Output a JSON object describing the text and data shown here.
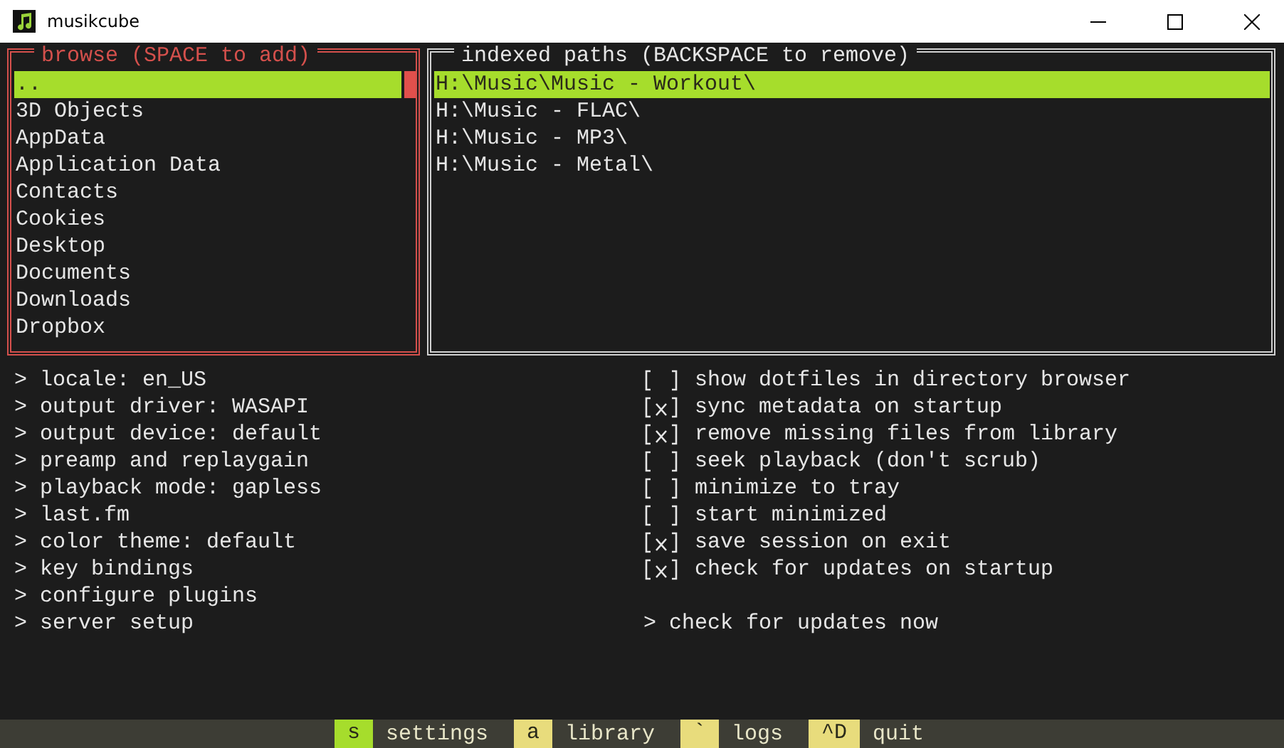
{
  "window": {
    "title": "musikcube"
  },
  "browse": {
    "title": "browse (SPACE to add)",
    "focused": true,
    "items": [
      {
        "label": "..",
        "selected": true
      },
      {
        "label": "3D Objects",
        "selected": false
      },
      {
        "label": "AppData",
        "selected": false
      },
      {
        "label": "Application Data",
        "selected": false
      },
      {
        "label": "Contacts",
        "selected": false
      },
      {
        "label": "Cookies",
        "selected": false
      },
      {
        "label": "Desktop",
        "selected": false
      },
      {
        "label": "Documents",
        "selected": false
      },
      {
        "label": "Downloads",
        "selected": false
      },
      {
        "label": "Dropbox",
        "selected": false
      }
    ]
  },
  "indexed": {
    "title": "indexed paths (BACKSPACE to remove)",
    "focused": false,
    "items": [
      {
        "label": "H:\\Music\\Music - Workout\\",
        "selected": true
      },
      {
        "label": "H:\\Music - FLAC\\",
        "selected": false
      },
      {
        "label": "H:\\Music - MP3\\",
        "selected": false
      },
      {
        "label": "H:\\Music - Metal\\",
        "selected": false
      }
    ]
  },
  "settings": [
    "> locale: en_US",
    "> output driver: WASAPI",
    "> output device: default",
    "> preamp and replaygain",
    "> playback mode: gapless",
    "> last.fm",
    "> color theme: default",
    "> key bindings",
    "> configure plugins",
    "> server setup"
  ],
  "options": [
    {
      "checked": false,
      "label": "show dotfiles in directory browser"
    },
    {
      "checked": true,
      "label": "sync metadata on startup"
    },
    {
      "checked": true,
      "label": "remove missing files from library"
    },
    {
      "checked": false,
      "label": "seek playback (don't scrub)"
    },
    {
      "checked": false,
      "label": "minimize to tray"
    },
    {
      "checked": false,
      "label": "start minimized"
    },
    {
      "checked": true,
      "label": "save session on exit"
    },
    {
      "checked": true,
      "label": "check for updates on startup"
    }
  ],
  "update_action": "> check for updates now",
  "footer": [
    {
      "key": "s",
      "label": "settings",
      "selected": true
    },
    {
      "key": "a",
      "label": "library",
      "selected": false
    },
    {
      "key": "`",
      "label": "logs",
      "selected": false
    },
    {
      "key": "^D",
      "label": "quit",
      "selected": false
    }
  ]
}
